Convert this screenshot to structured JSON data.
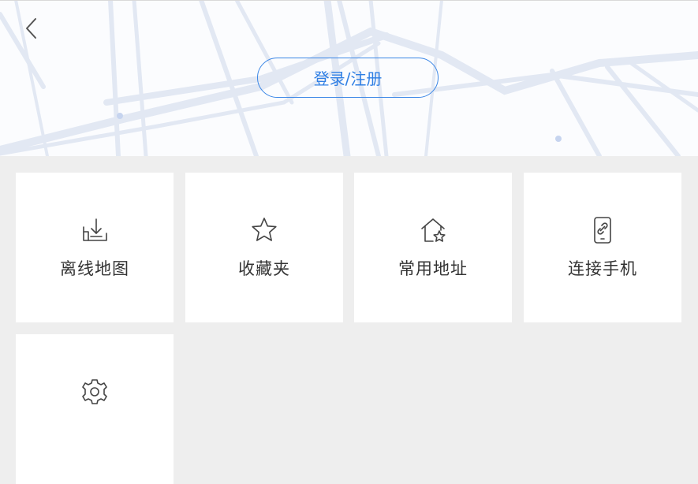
{
  "header": {
    "back_icon": "chevron-left-icon",
    "login_label": "登录/注册"
  },
  "menu": {
    "items": [
      {
        "label": "离线地图",
        "icon": "offline-map-download-icon"
      },
      {
        "label": "收藏夹",
        "icon": "star-icon"
      },
      {
        "label": "常用地址",
        "icon": "home-star-icon"
      },
      {
        "label": "连接手机",
        "icon": "phone-link-icon"
      },
      {
        "label": "",
        "icon": "gear-icon"
      }
    ]
  },
  "colors": {
    "accent": "#2f7fe4",
    "tile_bg": "#ffffff",
    "page_bg": "#eeeeee",
    "map_road": "#dfe5f1"
  }
}
